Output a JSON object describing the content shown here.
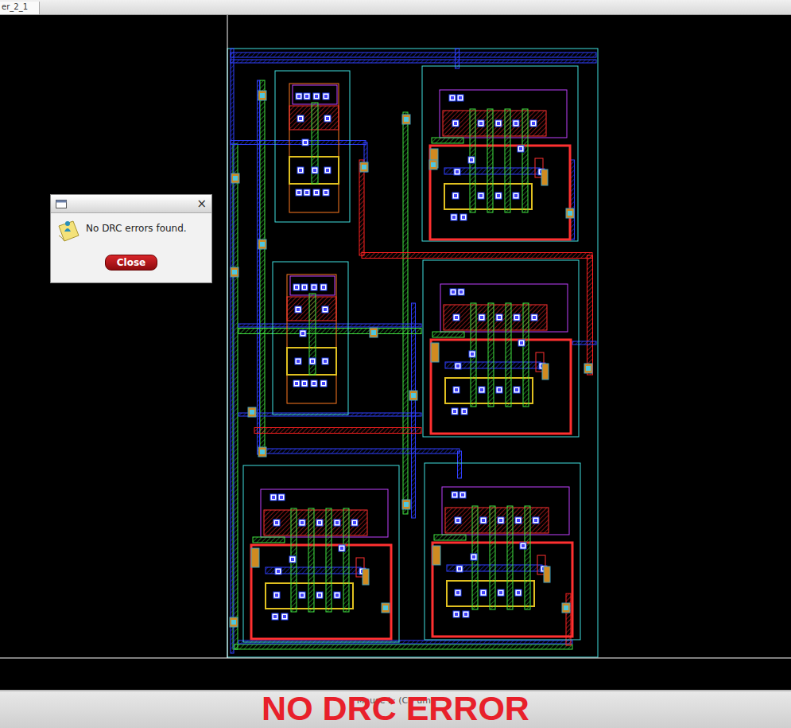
{
  "tab": {
    "label": "er_2_1"
  },
  "dialog": {
    "close_icon": "×",
    "message": "No DRC errors found.",
    "button": "Close"
  },
  "status_bar": {
    "text": "Mouse L: (CB um)"
  },
  "caption": "NO DRC ERROR"
}
